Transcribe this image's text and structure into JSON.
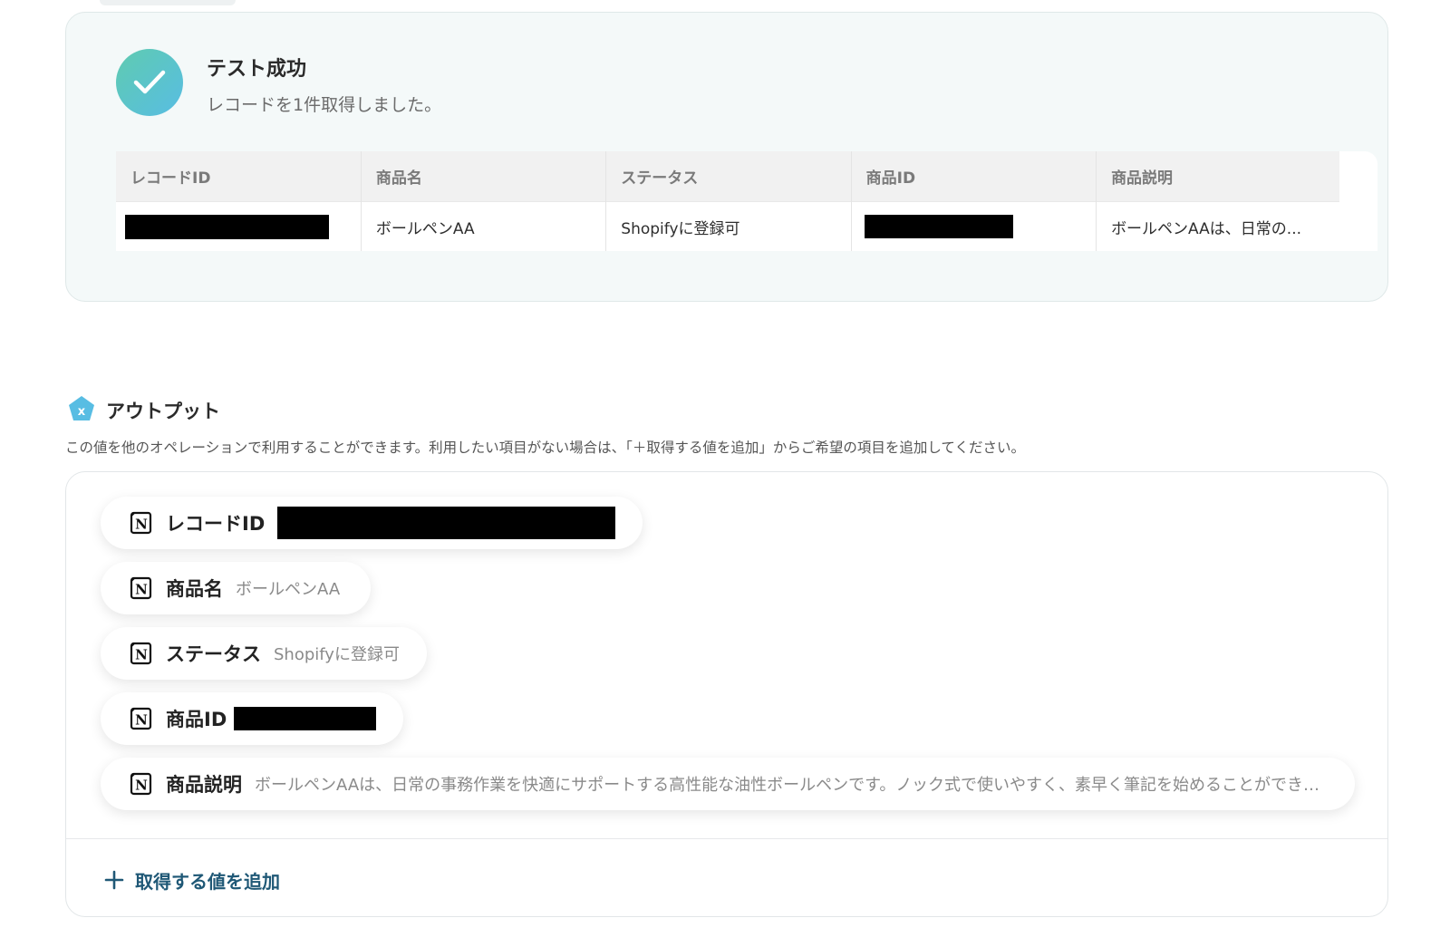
{
  "success": {
    "title": "テスト成功",
    "subtitle": "レコードを1件取得しました。"
  },
  "table": {
    "headers": [
      "レコードID",
      "商品名",
      "ステータス",
      "商品ID",
      "商品説明"
    ],
    "row": {
      "record_id": "",
      "product_name": "ボールペンAA",
      "status": "Shopifyに登録可",
      "product_id": "",
      "description": "ボールペンAAは、日常の..."
    }
  },
  "output": {
    "title": "アウトプット",
    "description": "この値を他のオペレーションで利用することができます。利用したい項目がない場合は、「＋取得する値を追加」からご希望の項目を追加してください。",
    "items": [
      {
        "label": "レコードID",
        "value": ""
      },
      {
        "label": "商品名",
        "value": "ボールペンAA"
      },
      {
        "label": "ステータス",
        "value": "Shopifyに登録可"
      },
      {
        "label": "商品ID",
        "value": ""
      },
      {
        "label": "商品説明",
        "value": "ボールペンAAは、日常の事務作業を快適にサポートする高性能な油性ボールペンです。ノック式で使いやすく、素早く筆記を始めることができま..."
      }
    ],
    "add_label": "取得する値を追加"
  },
  "colors": {
    "accent": "#1f5876",
    "success_start": "#5fcbb0",
    "success_end": "#58bde3",
    "output_icon": "#58bde3"
  },
  "icons": {
    "success": "check-icon",
    "output": "pentagon-x-icon",
    "item": "notion-icon",
    "add": "plus-icon"
  }
}
